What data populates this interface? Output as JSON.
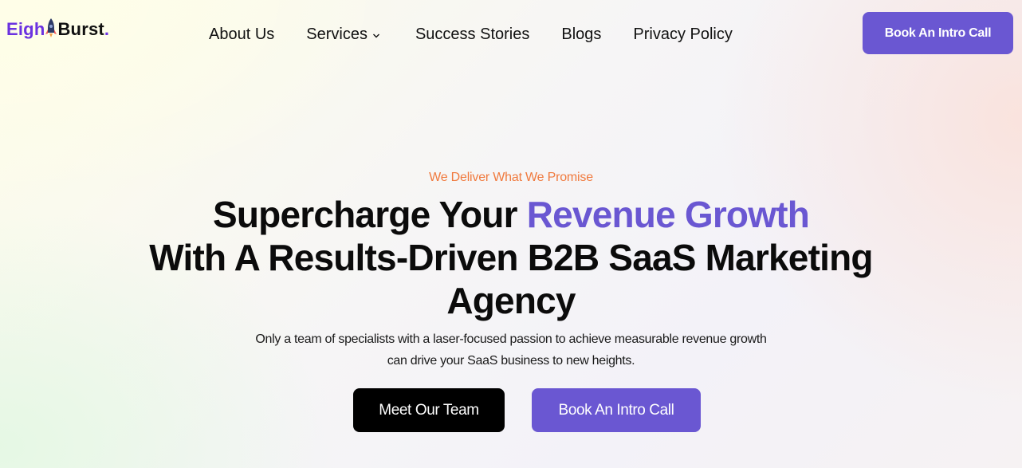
{
  "brand": {
    "logo_part1": "Eigh",
    "logo_part2": "Burst",
    "logo_dot": ".",
    "logo_icon": "rocket-icon",
    "colors": {
      "primary": "#6a57d2",
      "logo_purple": "#6b32e0",
      "tagline_orange": "#f07a3e",
      "dark": "#000000"
    }
  },
  "nav": {
    "items": [
      {
        "label": "About Us"
      },
      {
        "label": "Services",
        "icon": "chevron-down-icon"
      },
      {
        "label": "Success Stories"
      },
      {
        "label": "Blogs"
      },
      {
        "label": "Privacy Policy"
      }
    ],
    "cta_label": "Book An Intro Call"
  },
  "hero": {
    "tagline": "We Deliver What We Promise",
    "headline_part1": "Supercharge Your ",
    "headline_accent": "Revenue Growth",
    "headline_line2": "With A Results-Driven B2B SaaS Marketing",
    "headline_line3": "Agency",
    "subtext_line1": "Only a team of specialists with a laser-focused passion to achieve measurable revenue growth",
    "subtext_line2": "can drive your SaaS business to new heights.",
    "buttons": {
      "primary": "Meet Our Team",
      "secondary": "Book An Intro Call"
    }
  }
}
